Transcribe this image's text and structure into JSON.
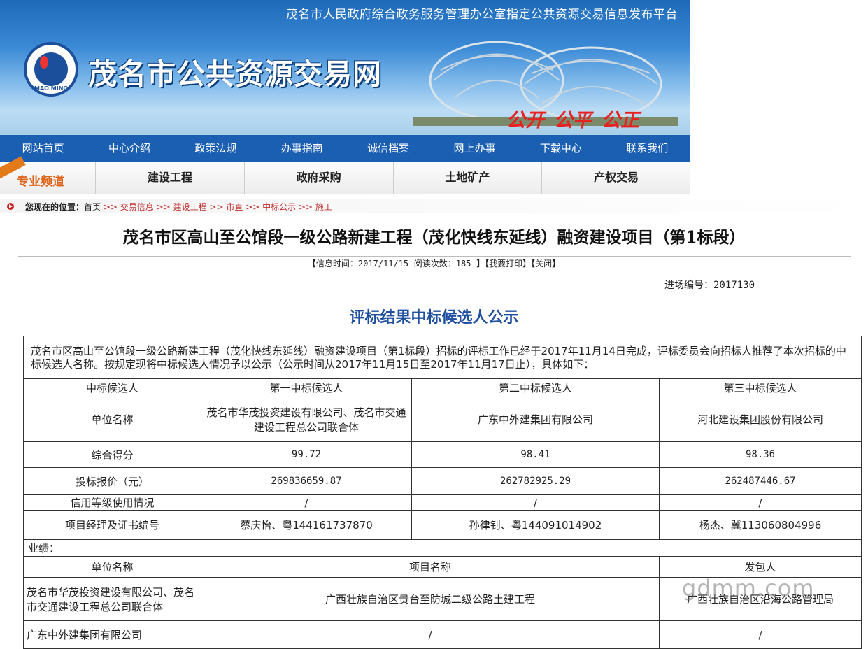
{
  "banner": {
    "top_notice": "茂名市人民政府综合政务服务管理办公室指定公共资源交易信息发布平台",
    "site_title": "茂名市公共资源交易网",
    "logo_text": "MAO MING",
    "slogan": [
      "公开",
      "公平",
      "公正"
    ]
  },
  "main_nav": [
    "网站首页",
    "中心介绍",
    "政策法规",
    "办事指南",
    "诚信档案",
    "网上办事",
    "下载中心",
    "联系我们"
  ],
  "channel": {
    "label": "专业频道",
    "tabs": [
      "建设工程",
      "政府采购",
      "土地矿产",
      "产权交易"
    ]
  },
  "breadcrumb": {
    "lead": "您现在的位置：",
    "home": "首页",
    "separator": ">>",
    "items": [
      "交易信息",
      "建设工程",
      "市直",
      "中标公示",
      "施工"
    ]
  },
  "article": {
    "title": "茂名市区高山至公馆段一级公路新建工程（茂化快线东延线）融资建设项目（第1标段）",
    "meta_info_label": "【信息时间：",
    "meta_date": "2017/11/15",
    "meta_views_label": "阅读次数：",
    "meta_views": "185",
    "meta_print": "】【我要打印】【关闭】",
    "project_no_label": "进场编号：",
    "project_no": "2017130",
    "notice_title": "评标结果中标候选人公示"
  },
  "result_table": {
    "intro": "茂名市区高山至公馆段一级公路新建工程（茂化快线东延线）融资建设项目（第1标段）招标的评标工作已经于2017年11月14日完成，评标委员会向招标人推荐了本次招标的中标候选人名称。按规定现将中标候选人情况予以公示（公示时间从2017年11月15日至2017年11月17日止），具体如下：",
    "headers": [
      "中标候选人",
      "第一中标候选人",
      "第二中标候选人",
      "第三中标候选人"
    ],
    "rows": [
      {
        "label": "单位名称",
        "values": [
          "茂名市华茂投资建设有限公司、茂名市交通建设工程总公司联合体",
          "广东中外建集团有限公司",
          "河北建设集团股份有限公司"
        ]
      },
      {
        "label": "综合得分",
        "values": [
          "99.72",
          "98.41",
          "98.36"
        ]
      },
      {
        "label": "投标报价（元）",
        "values": [
          "269836659.87",
          "262782925.29",
          "262487446.67"
        ]
      },
      {
        "label": "信用等级使用情况",
        "values": [
          "/",
          "/",
          "/"
        ]
      },
      {
        "label": "项目经理及证书编号",
        "values": [
          "蔡庆怡、粤144161737870",
          "孙律钊、粤144091014902",
          "杨杰、冀113060804996"
        ]
      }
    ],
    "performance_label": "业绩：",
    "perf_headers": [
      "单位名称",
      "项目名称",
      "发包人"
    ],
    "perf_rows": [
      {
        "unit": "茂名市华茂投资建设有限公司、茂名市交通建设工程总公司联合体",
        "project": "广西壮族自治区贵台至防城二级公路土建工程",
        "employer": "广西壮族自治区沿海公路管理局"
      },
      {
        "unit": "广东中外建集团有限公司",
        "project": "/",
        "employer": "/"
      }
    ]
  },
  "watermark": "gdmm.com"
}
